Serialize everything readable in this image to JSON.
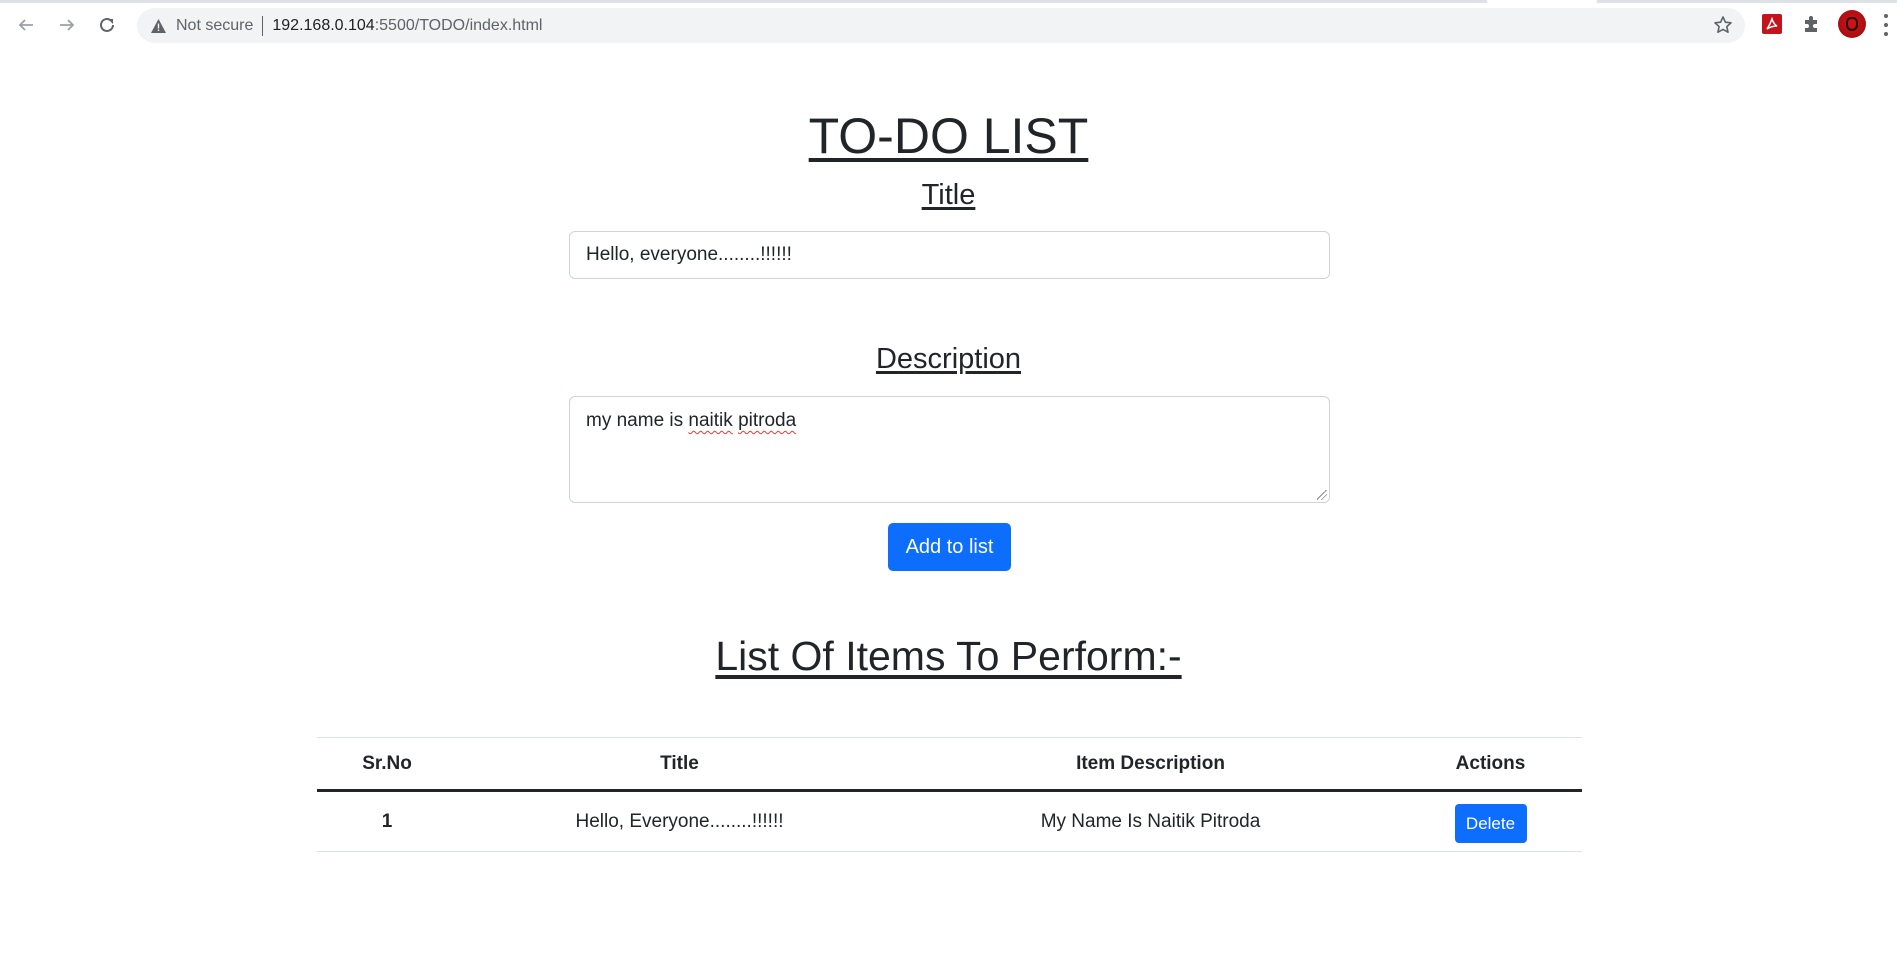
{
  "browser": {
    "back_icon": "arrow-left-icon",
    "forward_icon": "arrow-right-icon",
    "reload_icon": "reload-icon",
    "security_label": "Not secure",
    "url_host": "192.168.0.104",
    "url_path": ":5500/TODO/index.html",
    "extensions": [
      "bookmark-star-icon",
      "adobe-acrobat-icon",
      "extensions-puzzle-icon",
      "profile-avatar",
      "menu-kebab-icon"
    ]
  },
  "page": {
    "heading": "TO-DO LIST",
    "title_label": "Title",
    "title_value": "Hello, everyone........!!!!!!",
    "description_label": "Description",
    "description_value": {
      "plain": "my name is ",
      "misspelled_1": "naitik",
      "space": " ",
      "misspelled_2": "pitroda"
    },
    "add_button": "Add to list",
    "list_heading": "List Of Items To Perform:-"
  },
  "table": {
    "columns": [
      "Sr.No",
      "Title",
      "Item Description",
      "Actions"
    ],
    "rows": [
      {
        "sr": "1",
        "title": "Hello, Everyone........!!!!!!",
        "description": "My Name Is Naitik Pitroda",
        "action": "Delete"
      }
    ]
  },
  "colors": {
    "primary": "#0d6efd",
    "text": "#212529",
    "border": "#ced4da"
  }
}
